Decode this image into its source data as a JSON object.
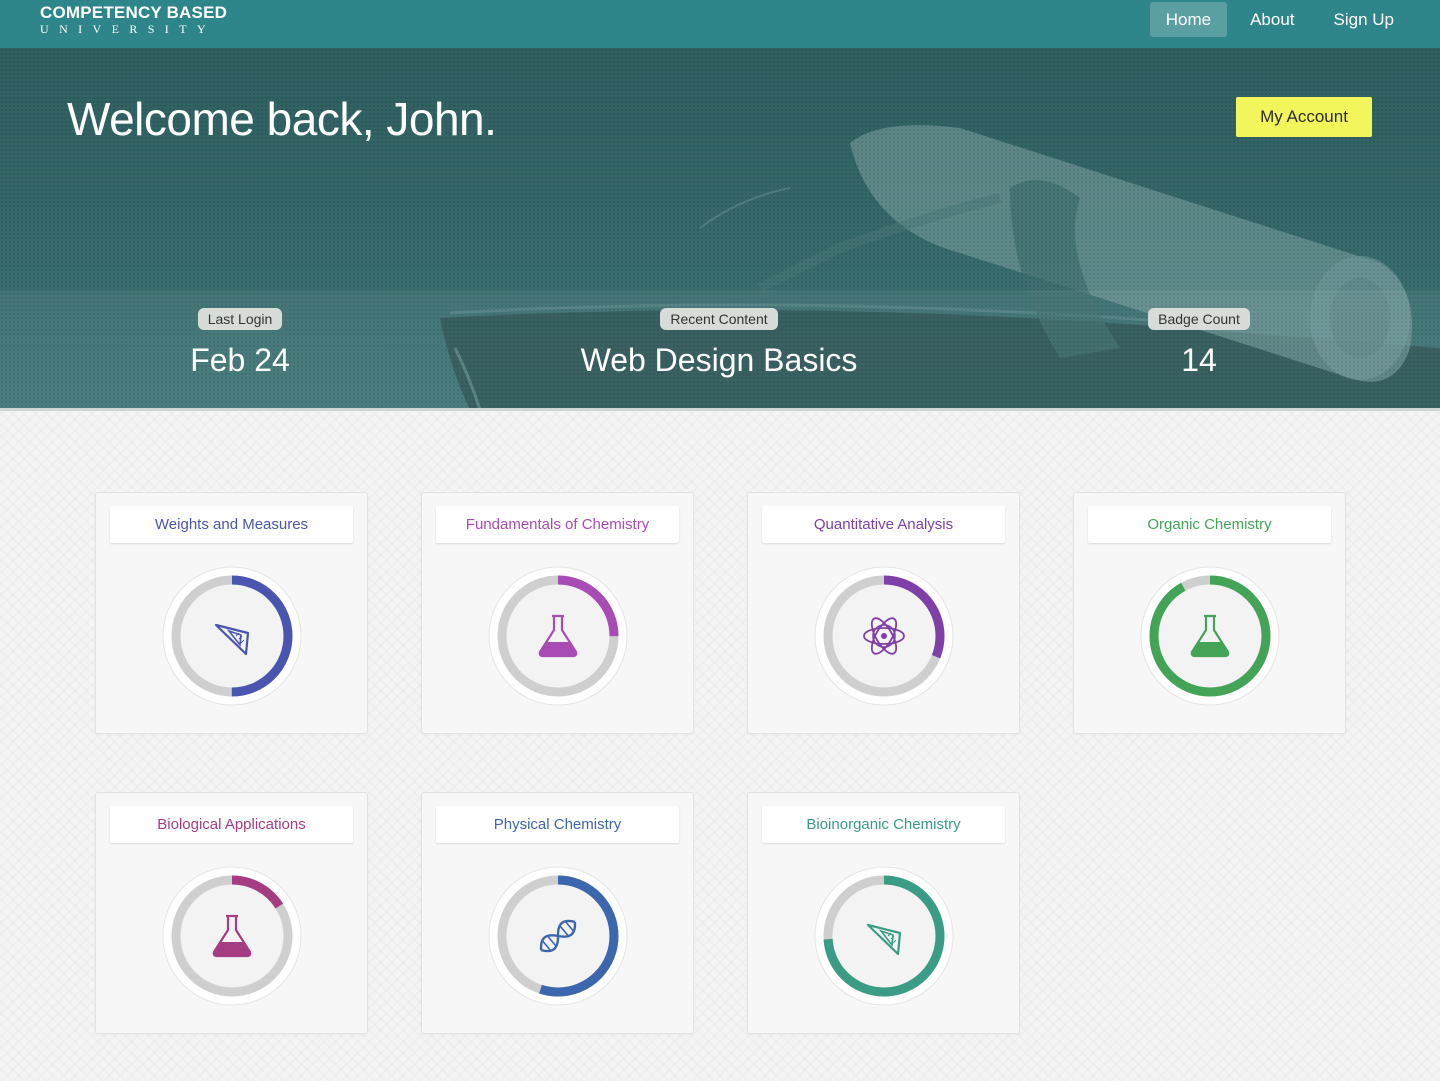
{
  "nav": {
    "logo_top": "COMPETENCY BASED",
    "logo_bottom": "UNIVERSITY",
    "links": [
      "Home",
      "About",
      "Sign Up"
    ],
    "active": "Home"
  },
  "hero": {
    "welcome": "Welcome back, John.",
    "account_button": "My Account",
    "stats": [
      {
        "label": "Last Login",
        "value": "Feb 24"
      },
      {
        "label": "Recent Content",
        "value": "Web Design Basics"
      },
      {
        "label": "Badge Count",
        "value": "14"
      }
    ]
  },
  "colors": {
    "nav_bg": "#2f868a",
    "account_button_bg": "#f2f65a",
    "ring_track": "#cfcfcf"
  },
  "courses": [
    {
      "title": "Weights and Measures",
      "color": "#4a55b0",
      "progress": 0.5,
      "icon": "set-square-icon"
    },
    {
      "title": "Fundamentals of Chemistry",
      "color": "#a94bb5",
      "progress": 0.25,
      "icon": "flask-icon"
    },
    {
      "title": "Quantitative Analysis",
      "color": "#7f3fa8",
      "progress": 0.31,
      "icon": "atom-icon"
    },
    {
      "title": "Organic Chemistry",
      "color": "#43a457",
      "progress": 0.92,
      "icon": "flask-icon"
    },
    {
      "title": "Biological Applications",
      "color": "#a63d83",
      "progress": 0.16,
      "icon": "flask-icon"
    },
    {
      "title": "Physical Chemistry",
      "color": "#3c66ad",
      "progress": 0.55,
      "icon": "dna-icon"
    },
    {
      "title": "Bioinorganic Chemistry",
      "color": "#3a9c84",
      "progress": 0.74,
      "icon": "set-square-icon"
    }
  ]
}
